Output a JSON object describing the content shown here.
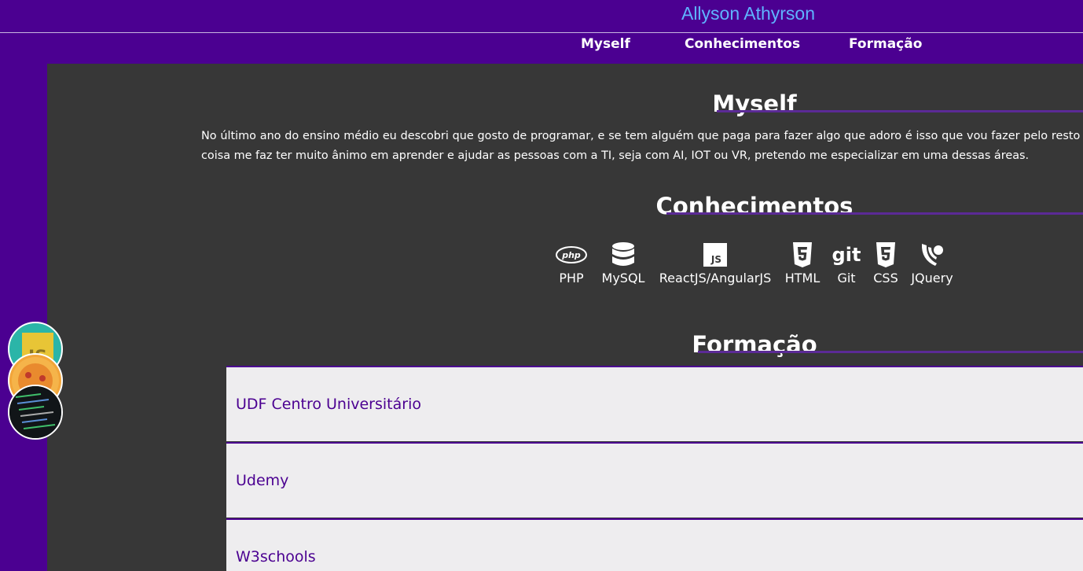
{
  "header": {
    "title": "Allyson Athyrson",
    "nav": [
      {
        "label": "Myself"
      },
      {
        "label": "Conhecimentos"
      },
      {
        "label": "Formação"
      }
    ]
  },
  "sections": {
    "myself": {
      "title": "Myself",
      "text": "No último ano do ensino médio eu descobri que gosto de programar, e se tem alguém que paga para fazer algo que adoro é isso que vou fazer pelo resto da vida, aprender qualquer coisa me faz ter muito ânimo em aprender e ajudar as pessoas com a TI, seja com AI, IOT ou VR, pretendo me especializar em uma dessas áreas."
    },
    "skills": {
      "title": "Conhecimentos",
      "items": [
        {
          "label": "PHP",
          "icon": "php-icon"
        },
        {
          "label": "MySQL",
          "icon": "database-icon"
        },
        {
          "label": "ReactJS/AngularJS",
          "icon": "js-icon"
        },
        {
          "label": "HTML",
          "icon": "html5-icon"
        },
        {
          "label": "Git",
          "icon": "git-icon"
        },
        {
          "label": "CSS",
          "icon": "css3-icon"
        },
        {
          "label": "JQuery",
          "icon": "jquery-icon"
        }
      ]
    },
    "education": {
      "title": "Formação",
      "items": [
        {
          "name": "UDF Centro Universitário"
        },
        {
          "name": "Udemy"
        },
        {
          "name": "W3schools"
        }
      ]
    }
  },
  "bubbles": [
    {
      "name": "js-logo-bubble"
    },
    {
      "name": "pizza-bubble"
    },
    {
      "name": "code-screen-bubble"
    }
  ],
  "colors": {
    "header_bg": "#4b0091",
    "title_color": "#5fb4ff",
    "content_bg": "#373737",
    "card_bg": "#eeedef",
    "accent": "#5b2a96"
  }
}
